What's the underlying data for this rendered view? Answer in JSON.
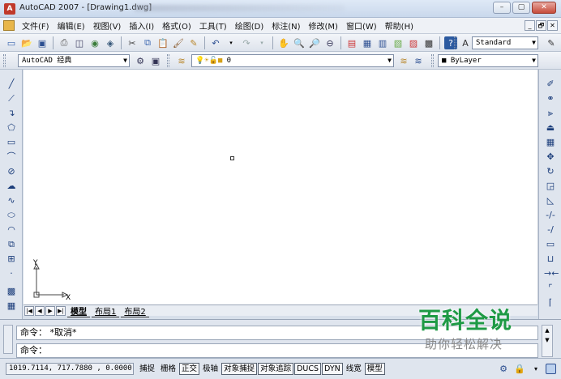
{
  "window": {
    "title": "AutoCAD 2007 - [Drawing1.dwg]",
    "app_icon": "autocad-icon",
    "controls": [
      "–",
      "▢",
      "✕"
    ]
  },
  "menubar": {
    "items": [
      "文件(F)",
      "编辑(E)",
      "视图(V)",
      "插入(I)",
      "格式(O)",
      "工具(T)",
      "绘图(D)",
      "标注(N)",
      "修改(M)",
      "窗口(W)",
      "帮助(H)"
    ],
    "mdi_controls": [
      "_",
      "🗗",
      "✕"
    ]
  },
  "toolbar_standard": {
    "text_style": "Standard"
  },
  "toolbar_workspace": {
    "workspace": "AutoCAD 经典",
    "layer": "0",
    "color": "ByLayer"
  },
  "canvas": {
    "ucs_y": "Y",
    "ucs_x": "X"
  },
  "layout_tabs": {
    "nav": [
      "|◀",
      "◀",
      "▶",
      "▶|"
    ],
    "tabs": [
      "模型",
      "布局1",
      "布局2"
    ]
  },
  "command": {
    "history": "命令： *取消*",
    "prompt": "命令："
  },
  "watermark": {
    "title": "百科全说",
    "subtitle": "助你轻松解决"
  },
  "statusbar": {
    "coordinates": "1019.7114, 717.7880 , 0.0000",
    "buttons": [
      {
        "label": "捕捉",
        "on": false
      },
      {
        "label": "栅格",
        "on": false
      },
      {
        "label": "正交",
        "on": true
      },
      {
        "label": "极轴",
        "on": false
      },
      {
        "label": "对象捕捉",
        "on": true
      },
      {
        "label": "对象追踪",
        "on": true
      },
      {
        "label": "DUCS",
        "on": true
      },
      {
        "label": "DYN",
        "on": true
      },
      {
        "label": "线宽",
        "on": false
      },
      {
        "label": "模型",
        "on": true
      }
    ]
  }
}
